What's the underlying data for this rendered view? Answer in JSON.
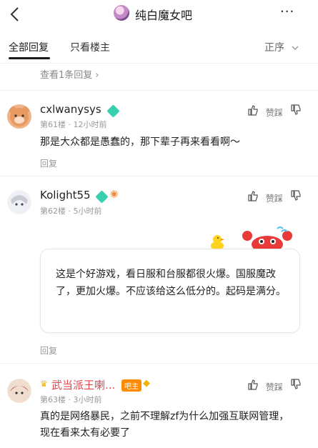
{
  "header": {
    "forum_title": "纯白魔女吧",
    "more_label": "···"
  },
  "tabs": {
    "all": "全部回复",
    "owner_only": "只看楼主",
    "sort": "正序"
  },
  "view_replies": "查看1条回复",
  "actions": {
    "reply": "回复",
    "like": "赞踩"
  },
  "posts": [
    {
      "username": "cxlwanysys",
      "floor": "第61楼",
      "time": "12小时前",
      "text": "那是大众都是愚蠢的，那下辈子再来看看啊～"
    },
    {
      "username": "Kolight55",
      "floor": "第62楼",
      "time": "5小时前",
      "text": "这是个好游戏，看日服和台服都很火爆。国服魔改了，更加火爆。不应该给这么低分的。起码是满分。"
    },
    {
      "username": "武当派王喇...",
      "owner_badge": "吧主",
      "floor": "第63楼",
      "time": "3小时前",
      "text": "真的是网络暴民，之前不理解zf为什么加强互联网管理，现在看来太有必要了"
    }
  ],
  "icons": {
    "back": "chevron-left-icon",
    "like": "thumbs-up-icon",
    "dislike": "thumbs-down-icon"
  }
}
